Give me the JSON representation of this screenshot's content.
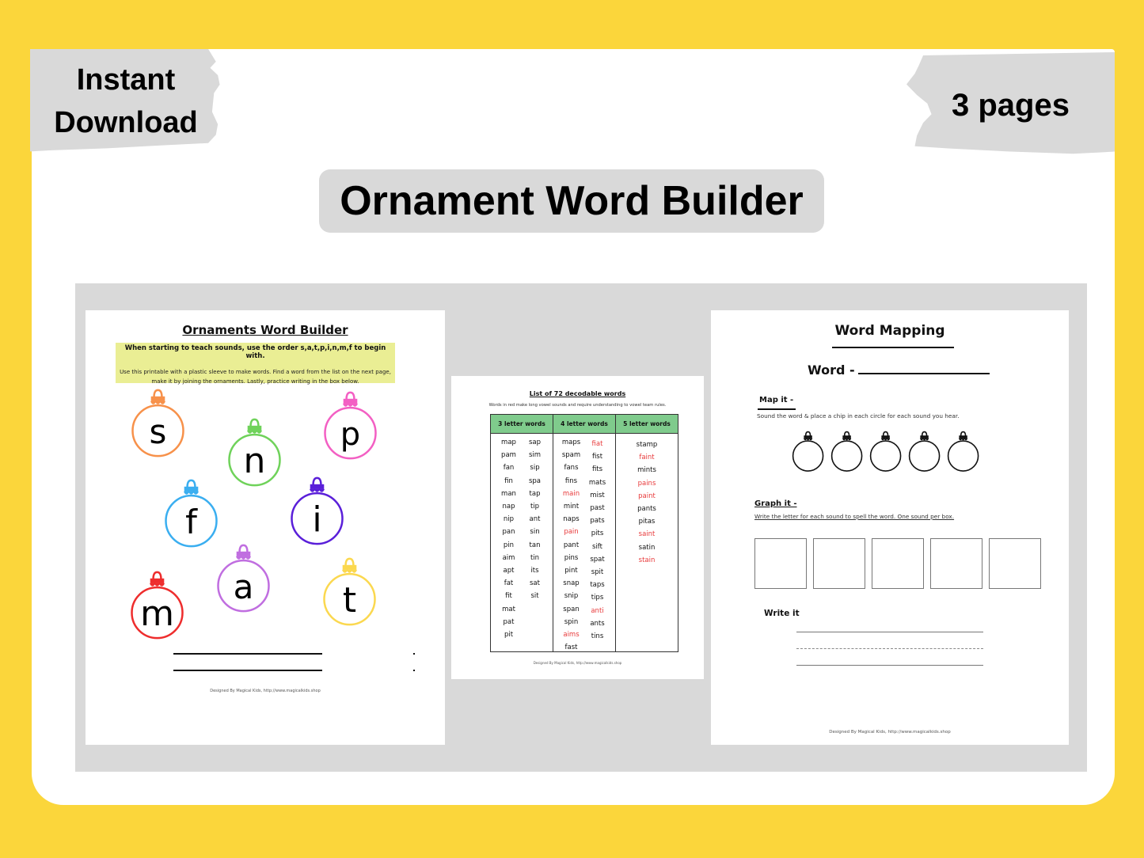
{
  "colors": {
    "background_yellow": "#fbd63b",
    "badge_gray": "#d9d9d9",
    "note_highlight": "#eaee94",
    "table_header_green": "#7fcb8c",
    "red_word": "#e8393a"
  },
  "badges": {
    "left_line1": "Instant",
    "left_line2": "Download",
    "right": "3 pages"
  },
  "title": "Ornament Word Builder",
  "pages": {
    "page1": {
      "title": "Ornaments Word Builder",
      "note_bold": "When starting to teach sounds, use the order s,a,t,p,i,n,m,f to begin with.",
      "note_body": "Use this printable with a plastic sleeve to make words. Find a word from the list on the next page, make it by joining the ornaments. Lastly, practice writing in the box below.",
      "ornaments": [
        {
          "letter": "s",
          "color": "#f7914a"
        },
        {
          "letter": "n",
          "color": "#6fd25a"
        },
        {
          "letter": "p",
          "color": "#f35fc3"
        },
        {
          "letter": "f",
          "color": "#3aaef0"
        },
        {
          "letter": "i",
          "color": "#5a1fd9"
        },
        {
          "letter": "a",
          "color": "#c06ee0"
        },
        {
          "letter": "m",
          "color": "#ee2d2d"
        },
        {
          "letter": "t",
          "color": "#fbd84f"
        }
      ],
      "footer": "Designed By Magical Kids, http://www.magicalkids.shop"
    },
    "page2": {
      "title": "List of 72 decodable words",
      "subtitle": "Words in red make long vowel sounds and require understanding to vowel team rules.",
      "headers": [
        "3 letter words",
        "4 letter words",
        "5 letter words"
      ],
      "columns": [
        [
          [
            {
              "w": "map"
            },
            {
              "w": "pam"
            },
            {
              "w": "fan"
            },
            {
              "w": "fin"
            },
            {
              "w": "man"
            },
            {
              "w": "nap"
            },
            {
              "w": "nip"
            },
            {
              "w": "pan"
            },
            {
              "w": "pin"
            },
            {
              "w": "aim"
            },
            {
              "w": "apt"
            },
            {
              "w": "fat"
            },
            {
              "w": "fit"
            },
            {
              "w": "mat"
            },
            {
              "w": "pat"
            },
            {
              "w": "pit"
            }
          ],
          [
            {
              "w": "sap"
            },
            {
              "w": "sim"
            },
            {
              "w": "sip"
            },
            {
              "w": "spa"
            },
            {
              "w": "tap"
            },
            {
              "w": "tip"
            },
            {
              "w": "ant"
            },
            {
              "w": "sin"
            },
            {
              "w": "tan"
            },
            {
              "w": "tin"
            },
            {
              "w": "its"
            },
            {
              "w": "sat"
            },
            {
              "w": "sit"
            }
          ]
        ],
        [
          [
            {
              "w": "maps"
            },
            {
              "w": "spam"
            },
            {
              "w": "fans"
            },
            {
              "w": "fins"
            },
            {
              "w": "main",
              "red": true
            },
            {
              "w": "mint"
            },
            {
              "w": "naps"
            },
            {
              "w": "pain",
              "red": true
            },
            {
              "w": "pant"
            },
            {
              "w": "pins"
            },
            {
              "w": "pint"
            },
            {
              "w": "snap"
            },
            {
              "w": "snip"
            },
            {
              "w": "span"
            },
            {
              "w": "spin"
            },
            {
              "w": "aims",
              "red": true
            },
            {
              "w": "fast"
            }
          ],
          [
            {
              "w": "fiat",
              "red": true
            },
            {
              "w": "fist"
            },
            {
              "w": "fits"
            },
            {
              "w": "mats"
            },
            {
              "w": "mist"
            },
            {
              "w": "past"
            },
            {
              "w": "pats"
            },
            {
              "w": "pits"
            },
            {
              "w": "sift"
            },
            {
              "w": "spat"
            },
            {
              "w": "spit"
            },
            {
              "w": "taps"
            },
            {
              "w": "tips"
            },
            {
              "w": "anti",
              "red": true
            },
            {
              "w": "ants"
            },
            {
              "w": "tins"
            }
          ]
        ],
        [
          [
            {
              "w": "stamp"
            },
            {
              "w": "faint",
              "red": true
            },
            {
              "w": "mints"
            },
            {
              "w": "pains",
              "red": true
            },
            {
              "w": "paint",
              "red": true
            },
            {
              "w": "pants"
            },
            {
              "w": "pitas"
            },
            {
              "w": "saint",
              "red": true
            },
            {
              "w": "satin"
            },
            {
              "w": "stain",
              "red": true
            }
          ]
        ]
      ],
      "footer": "Designed By Magical Kids, http://www.magicalkids.shop"
    },
    "page3": {
      "title": "Word Mapping",
      "word_label": "Word -",
      "map_label": "Map it -",
      "map_text": "Sound the word & place a chip in each circle for each sound you hear.",
      "map_circle_count": 5,
      "graph_label": "Graph it -",
      "graph_text": "Write the letter for each sound to spell the word. One sound per box.",
      "graph_box_count": 5,
      "write_label": "Write it",
      "footer": "Designed By Magical Kids, http://www.magicalkids.shop"
    }
  }
}
